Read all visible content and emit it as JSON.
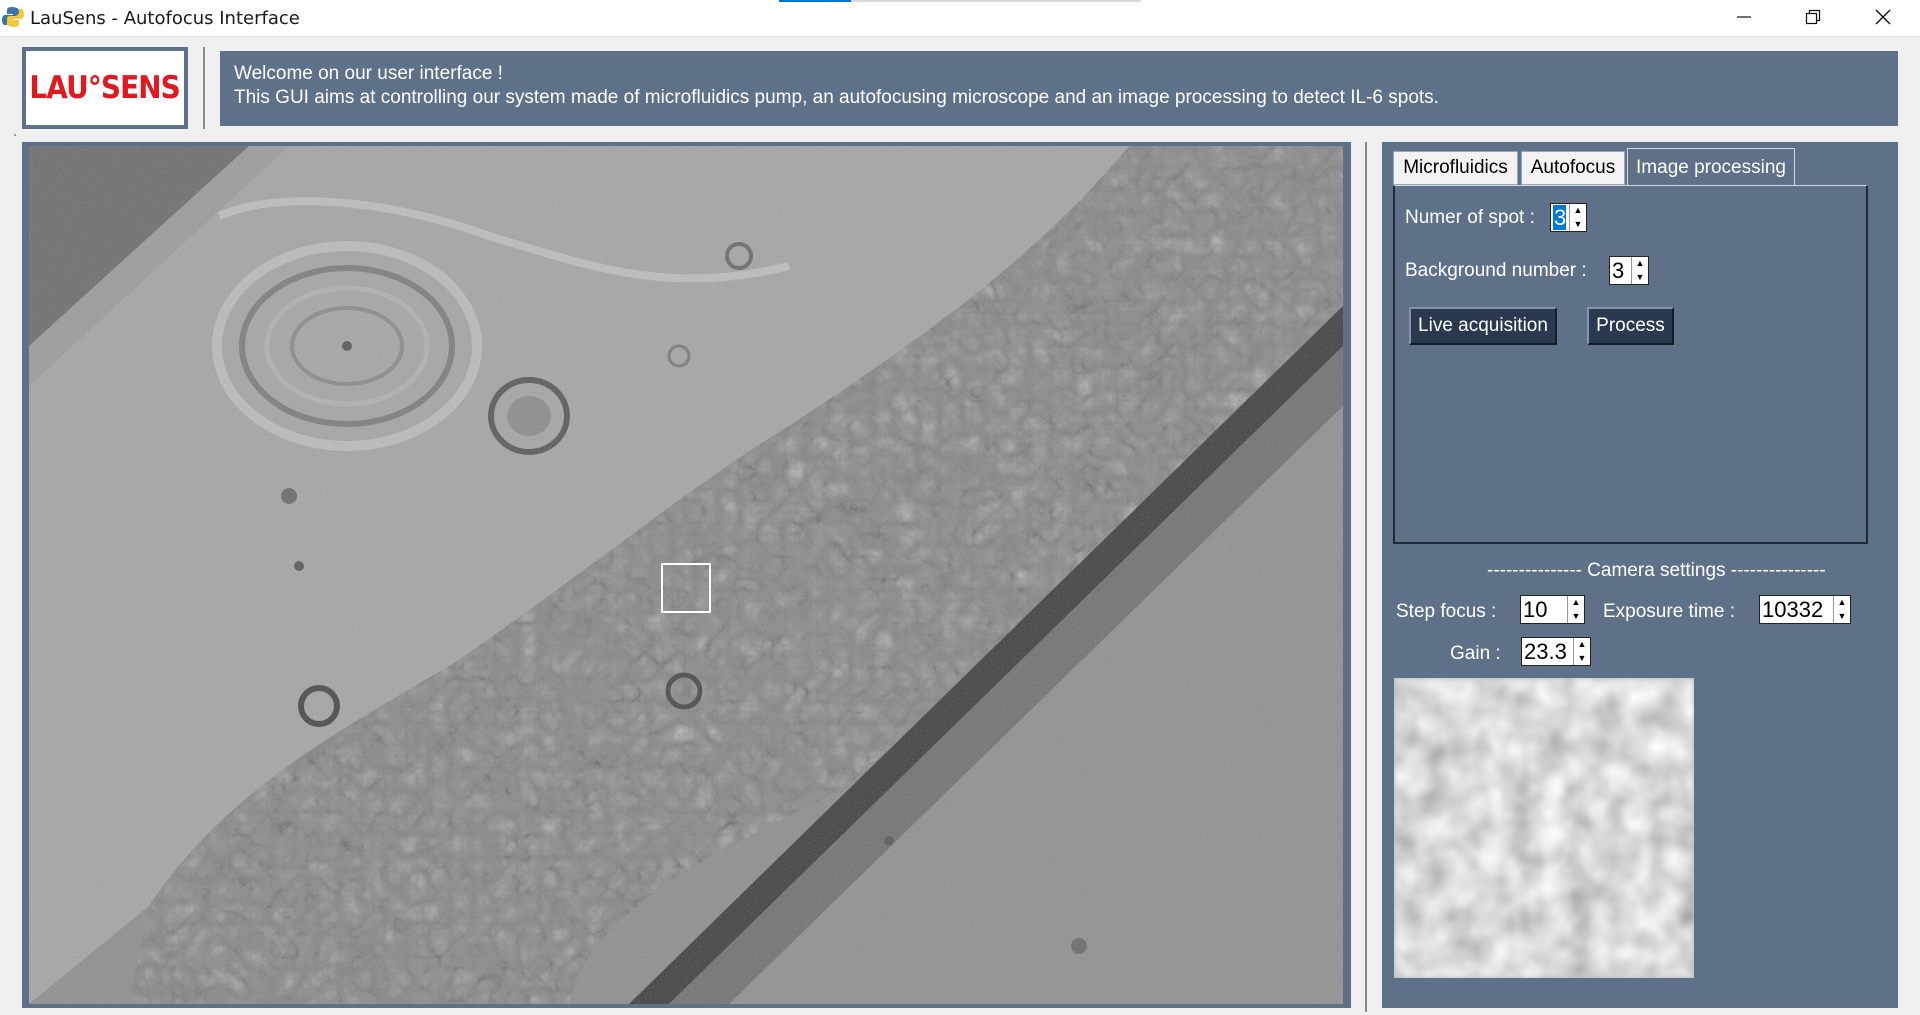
{
  "window": {
    "title": "LauSens - Autofocus Interface",
    "controls": [
      "minimize-icon",
      "restore-icon",
      "close-icon"
    ]
  },
  "header": {
    "logo_text": "LAU°SENS",
    "welcome_line1": "Welcome on our user interface !",
    "welcome_line2": "This GUI aims at controlling our system made of microfluidics pump, an autofocusing microscope and an image processing to detect IL-6 spots."
  },
  "tabs": [
    {
      "label": "Microfluidics",
      "active": false
    },
    {
      "label": "Autofocus",
      "active": false
    },
    {
      "label": "Image processing",
      "active": true
    }
  ],
  "image_processing": {
    "spot_label": "Numer of spot :",
    "spot_value": "3",
    "background_label": "Background number :",
    "background_value": "3",
    "live_button": "Live acquisition",
    "process_button": "Process"
  },
  "camera": {
    "heading": "---------------   Camera settings   ---------------",
    "step_focus_label": "Step focus :",
    "step_focus_value": "10",
    "exposure_label": "Exposure time :",
    "exposure_value": "10332",
    "gain_label": "Gain :",
    "gain_value": "23.3"
  },
  "colors": {
    "panel": "#5f7189",
    "button": "#2a3850",
    "logo_red": "#e3171e",
    "selection": "#0078d7"
  }
}
